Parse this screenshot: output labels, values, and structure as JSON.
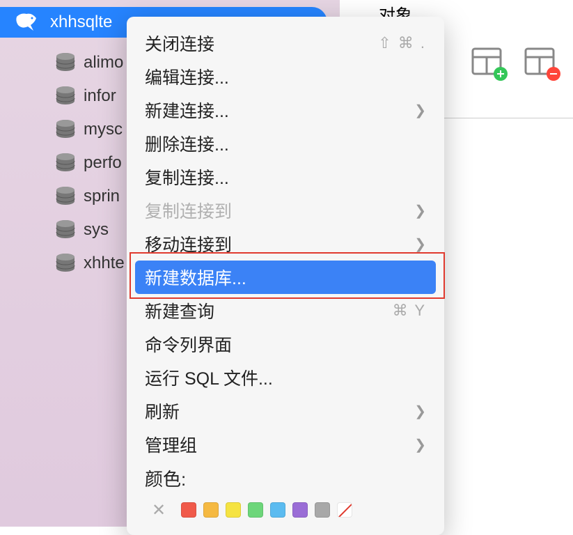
{
  "connection": {
    "name": "xhhsqlte"
  },
  "databases": [
    {
      "name": "alimo"
    },
    {
      "name": "infor"
    },
    {
      "name": "mysc"
    },
    {
      "name": "perfo"
    },
    {
      "name": "sprin"
    },
    {
      "name": "sys"
    },
    {
      "name": "xhhte"
    }
  ],
  "topRight": {
    "label": "对象"
  },
  "contextMenu": {
    "items": [
      {
        "label": "关闭连接",
        "shortcut": "⇧ ⌘ .",
        "hasSubmenu": false
      },
      {
        "label": "编辑连接...",
        "hasSubmenu": false
      },
      {
        "label": "新建连接...",
        "hasSubmenu": true
      },
      {
        "label": "删除连接...",
        "hasSubmenu": false
      },
      {
        "label": "复制连接...",
        "hasSubmenu": false
      },
      {
        "label": "复制连接到",
        "hasSubmenu": true,
        "disabled": true
      },
      {
        "label": "移动连接到",
        "hasSubmenu": true
      },
      {
        "label": "新建数据库...",
        "highlighted": true
      },
      {
        "label": "新建查询",
        "shortcut": "⌘ Y"
      },
      {
        "label": "命令列界面",
        "hasSubmenu": false
      },
      {
        "label": "运行 SQL 文件...",
        "hasSubmenu": false
      },
      {
        "label": "刷新",
        "hasSubmenu": true
      },
      {
        "label": "管理组",
        "hasSubmenu": true
      }
    ],
    "colorLabel": "颜色:",
    "colorSwatches": [
      "#f05a4a",
      "#f5b942",
      "#f5e342",
      "#6dd67a",
      "#5bbbf0",
      "#9a6dd6",
      "#a8a8a8"
    ]
  }
}
